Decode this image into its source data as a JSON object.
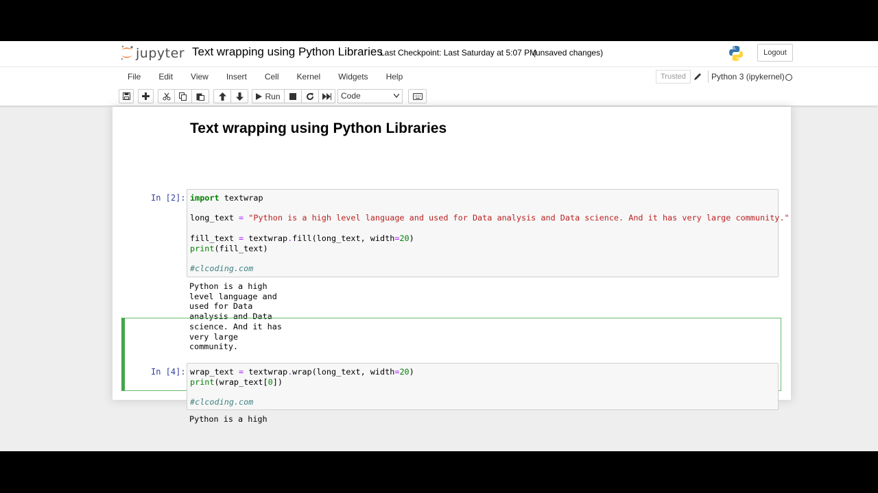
{
  "header": {
    "logo_text": "jupyter",
    "notebook_title": "Text wrapping using Python Libraries",
    "checkpoint": "Last Checkpoint: Last Saturday at 5:07 PM",
    "unsaved": "(unsaved changes)",
    "logout_label": "Logout"
  },
  "menubar": {
    "items": [
      "File",
      "Edit",
      "View",
      "Insert",
      "Cell",
      "Kernel",
      "Widgets",
      "Help"
    ],
    "trusted_label": "Trusted",
    "kernel_name": "Python 3 (ipykernel)"
  },
  "toolbar": {
    "run_label": "Run",
    "cell_type": "Code"
  },
  "notebook": {
    "heading": "Text wrapping using Python Libraries",
    "cells": [
      {
        "prompt": "In [2]:",
        "code_lines": [
          "import textwrap",
          "",
          "long_text = \"Python is a high level language and used for Data analysis and Data science. And it has very large community.\"",
          "",
          "fill_text = textwrap.fill(long_text, width=20)",
          "print(fill_text)",
          "",
          "#clcoding.com"
        ],
        "output_lines": [
          "Python is a high",
          "level language and",
          "used for Data",
          "analysis and Data",
          "science. And it has",
          "very large",
          "community."
        ]
      },
      {
        "prompt": "In [4]:",
        "code_lines": [
          "wrap_text = textwrap.wrap(long_text, width=20)",
          "print(wrap_text[0])",
          "",
          "#clcoding.com"
        ],
        "output_lines": [
          "Python is a high"
        ]
      }
    ]
  },
  "colors": {
    "selected_cell_border": "#42a548",
    "prompt": "#303f9f",
    "keyword": "#008000",
    "string": "#ba2121",
    "comment": "#408080"
  }
}
